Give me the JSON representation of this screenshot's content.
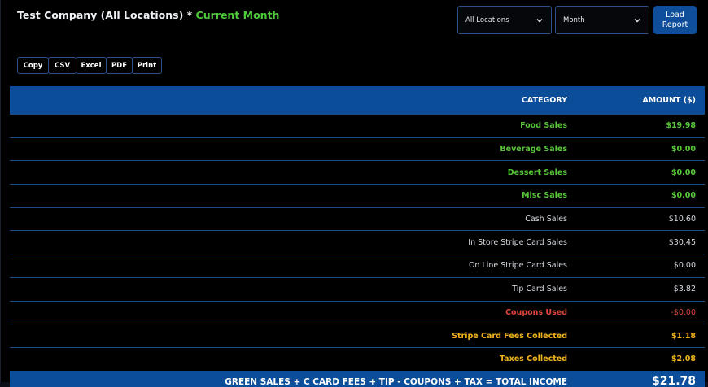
{
  "header": {
    "title_main": "Test Company (All Locations) *",
    "title_accent": "Current Month"
  },
  "filters": {
    "location": "All Locations",
    "period": "Month",
    "load_label": "Load Report"
  },
  "export_buttons": [
    "Copy",
    "CSV",
    "Excel",
    "PDF",
    "Print"
  ],
  "table": {
    "columns": [
      "CATEGORY",
      "AMOUNT ($)"
    ],
    "rows": [
      {
        "category": "Food Sales",
        "amount": "$19.98"
      },
      {
        "category": "Beverage Sales",
        "amount": "$0.00"
      },
      {
        "category": "Dessert Sales",
        "amount": "$0.00"
      },
      {
        "category": "Misc Sales",
        "amount": "$0.00"
      },
      {
        "category": "Cash Sales",
        "amount": "$10.60"
      },
      {
        "category": "In Store Stripe Card Sales",
        "amount": "$30.45"
      },
      {
        "category": "On Line Stripe Card Sales",
        "amount": "$0.00"
      },
      {
        "category": "Tip Card Sales",
        "amount": "$3.82"
      },
      {
        "category": "Coupons Used",
        "amount": "-$0.00"
      },
      {
        "category": "Stripe Card Fees Collected",
        "amount": "$1.18"
      },
      {
        "category": "Taxes Collected",
        "amount": "$2.08"
      }
    ],
    "footer": {
      "category": "GREEN SALES + C CARD FEES + TIP - COUPONS + TAX = TOTAL INCOME",
      "amount": "$21.78"
    }
  },
  "colors": {
    "accent_green": "#58c63a",
    "header_blue": "#0b4d98",
    "coupon_red": "#e0443c",
    "fee_gold": "#f0b21c"
  }
}
